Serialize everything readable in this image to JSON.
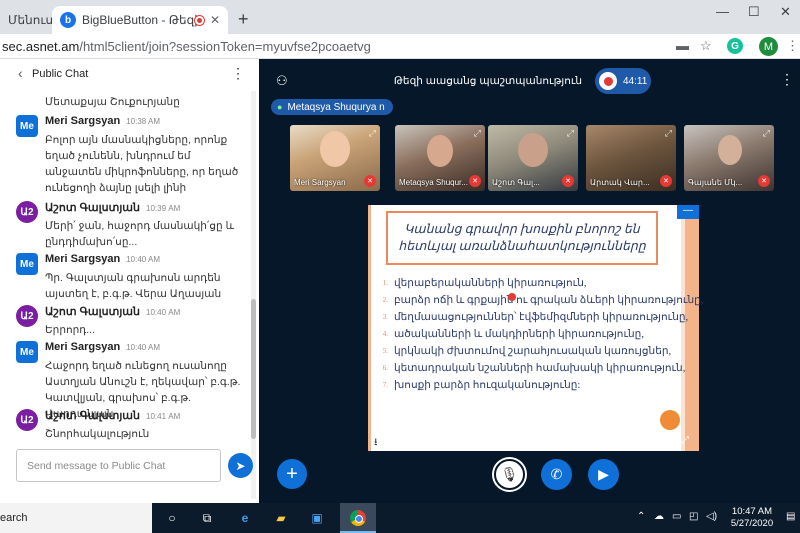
{
  "browser": {
    "tabs": [
      {
        "label": "Մենուստ..."
      },
      {
        "label": "BigBlueButton - Թեզի աացալ"
      }
    ],
    "url_host": "sec.asnet.am",
    "url_path": "/html5client/join?sessionToken=myuvfse2pcoaetvg",
    "profile_initial": "M",
    "extension_initial": "G"
  },
  "chat": {
    "title": "Public Chat",
    "top_snippet": "Մետաքսյա Շուքուրյանը",
    "messages": [
      {
        "avatar": "Me",
        "role": "mod",
        "name": "Meri Sargsyan",
        "time": "10:38 AM",
        "text": "Բոլոր այն մասնակիցները, որոնք եղած չունենն, խնդրում եմ անջատեն միկրոֆոնները, որ եղած ունեցողի ձայնը լսելի լինի"
      },
      {
        "avatar": "Ա2",
        "role": "user",
        "name": "Աշոտ Գալստյան",
        "time": "10:39 AM",
        "text": "Մերի՛ ջան, հաջորդ մասնակի՛ցը և ընդդիմախո՛սը..."
      },
      {
        "avatar": "Me",
        "role": "mod",
        "name": "Meri Sargsyan",
        "time": "10:40 AM",
        "text": "Պր. Գալստյան գրախոսն արդեն այստեղ է, բ.գ.թ. Վերա Աղասյան"
      },
      {
        "avatar": "Ա2",
        "role": "user",
        "name": "Աշոտ Գալստյան",
        "time": "10:40 AM",
        "text": "Երրորդ..."
      },
      {
        "avatar": "Me",
        "role": "mod",
        "name": "Meri Sargsyan",
        "time": "10:40 AM",
        "text": "Հաջորդ եղած ունեցող ուսանողը Աստղյան Անուշն է, ղեկավար՝ բ.գ.թ. Կատվլյան, գրախոս՝ բ.գ.թ. Վարդանյան"
      },
      {
        "avatar": "Ա2",
        "role": "user",
        "name": "Աշոտ Գալստյան",
        "time": "10:41 AM",
        "text": "Շնորհակալություն"
      }
    ],
    "input_placeholder": "Send message to Public Chat"
  },
  "meeting": {
    "title": "Թեզի աացանց պաշտպանություն",
    "timer": "44:11",
    "talker": "Metaqsya Shuqurya n"
  },
  "videos": [
    {
      "name": "Meri Sargsyan"
    },
    {
      "name": "Metaqsya Shuqur..."
    },
    {
      "name": "Աշոտ Գալ..."
    },
    {
      "name": "Արտակ Վար..."
    },
    {
      "name": "Գայանե Մկ..."
    }
  ],
  "slide": {
    "title": "Կանանց գրավոր խոսքին բնորոշ են հետևյալ առանձնահատկությունները",
    "items": [
      "վերաբերականների կիրառություն,",
      "բարձր ոճի և գրքային ու գրական ձևերի կիրառությունը,",
      "մեղմասացություններ՝ էվֆեմիզմների կիրառությունը,",
      "ածականների և մակդիրների կիրառությունը,",
      "կրկնակի ժխտումով շարահյուսական կառույցներ,",
      "կետադրական նշանների համախակի կիրառություն,",
      "խոսքի բարձր հուզականությունը:"
    ]
  },
  "taskbar": {
    "search": "earch",
    "time": "10:47 AM",
    "date": "5/27/2020"
  }
}
